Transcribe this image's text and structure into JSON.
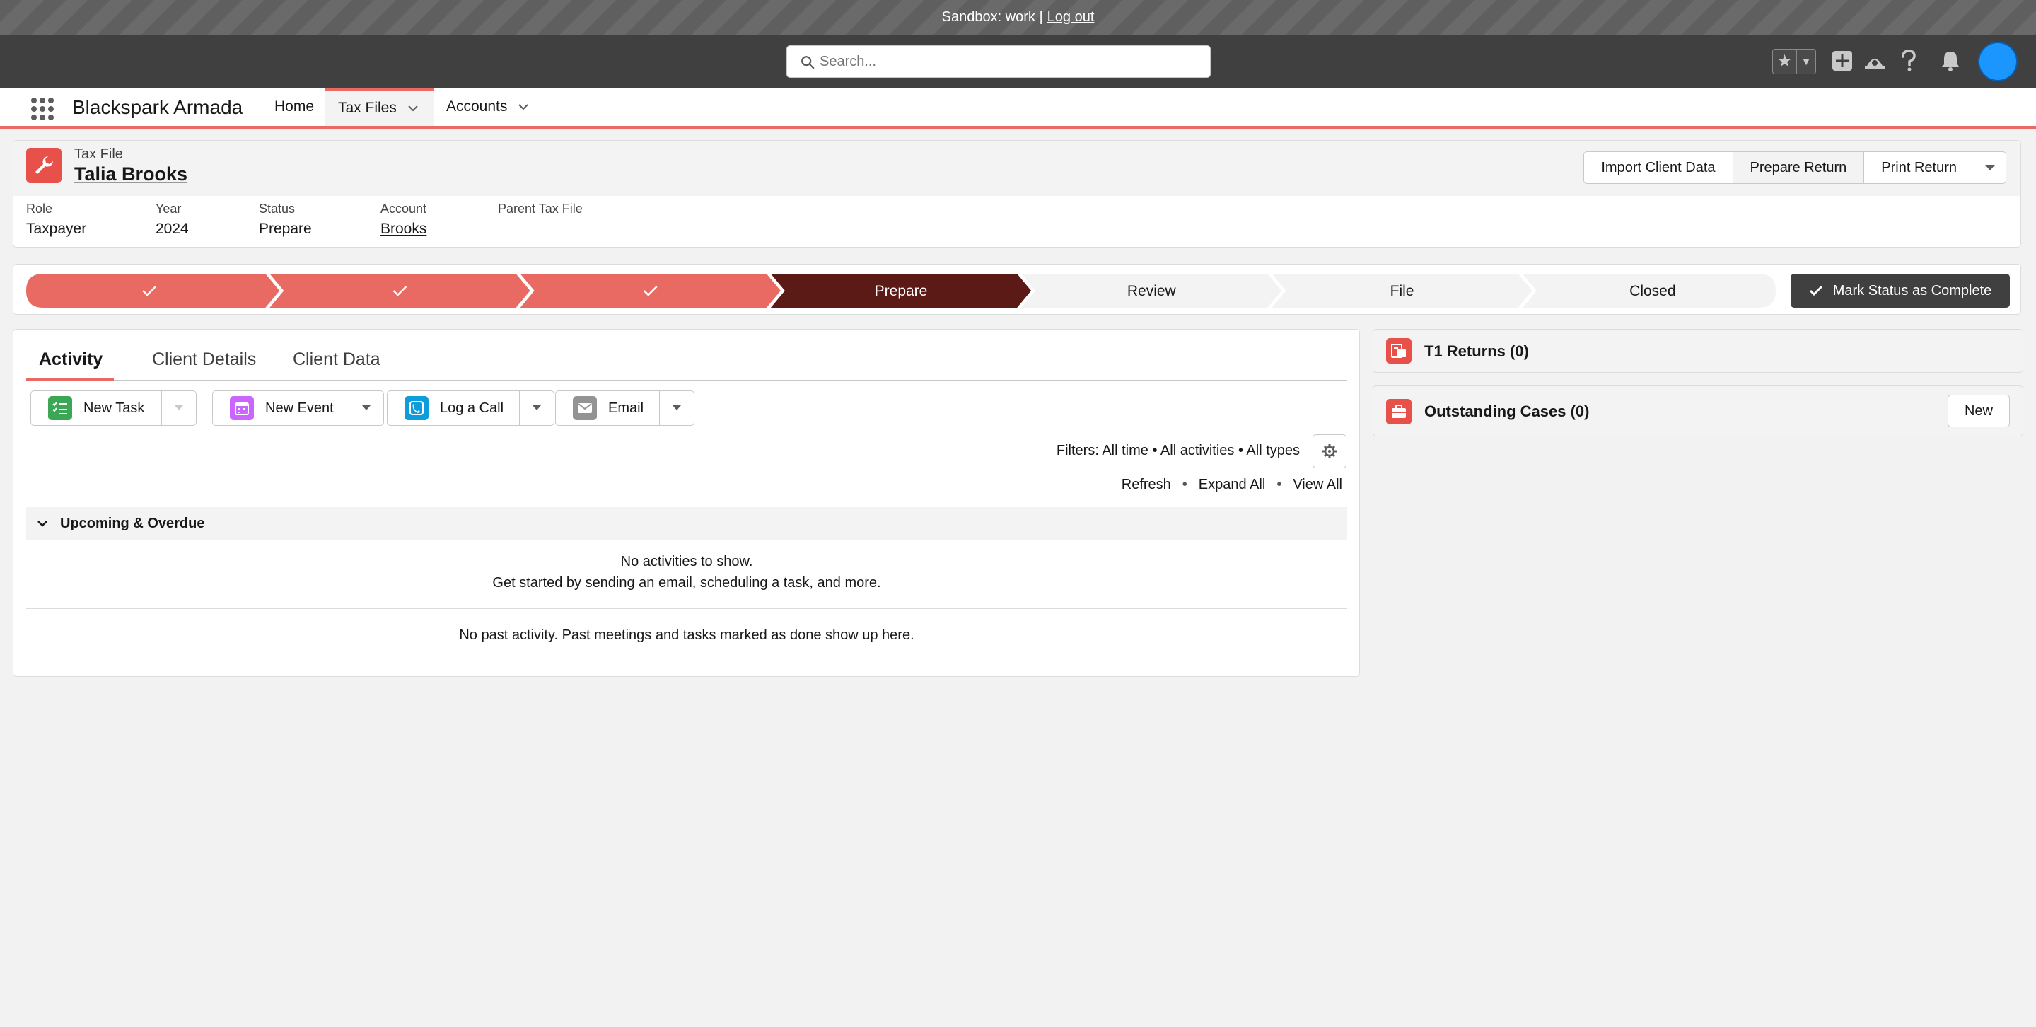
{
  "sandbox": {
    "text": "Sandbox: work |",
    "logout": "Log out"
  },
  "header": {
    "search_placeholder": "Search..."
  },
  "nav": {
    "app_name": "Blackspark Armada",
    "items": [
      {
        "label": "Home"
      },
      {
        "label": "Tax Files"
      },
      {
        "label": "Accounts"
      }
    ]
  },
  "record": {
    "type": "Tax File",
    "name": "Talia Brooks",
    "actions": [
      "Import Client Data",
      "Prepare Return",
      "Print Return"
    ],
    "fields": [
      {
        "label": "Role",
        "value": "Taxpayer"
      },
      {
        "label": "Year",
        "value": "2024"
      },
      {
        "label": "Status",
        "value": "Prepare"
      },
      {
        "label": "Account",
        "value": "Brooks"
      },
      {
        "label": "Parent Tax File",
        "value": ""
      }
    ]
  },
  "path": {
    "stages": [
      "",
      "",
      "",
      "Prepare",
      "Review",
      "File",
      "Closed"
    ],
    "current": "Prepare",
    "mark_label": "Mark Status as Complete",
    "colors": {
      "complete": "#e86a63",
      "current": "#5c1a17",
      "incomplete": "#f3f3f3"
    }
  },
  "activity": {
    "tabs": [
      "Activity",
      "Client Details",
      "Client Data"
    ],
    "buttons": [
      "New Task",
      "New Event",
      "Log a Call",
      "Email"
    ],
    "filters": "Filters: All time • All activities • All types",
    "links": [
      "Refresh",
      "Expand All",
      "View All"
    ],
    "upcoming_label": "Upcoming & Overdue",
    "empty_line1": "No activities to show.",
    "empty_line2": "Get started by sending an email, scheduling a task, and more.",
    "past_empty": "No past activity. Past meetings and tasks marked as done show up here."
  },
  "related": {
    "t1_returns": "T1 Returns (0)",
    "outstanding_cases": "Outstanding Cases (0)",
    "new_label": "New"
  }
}
